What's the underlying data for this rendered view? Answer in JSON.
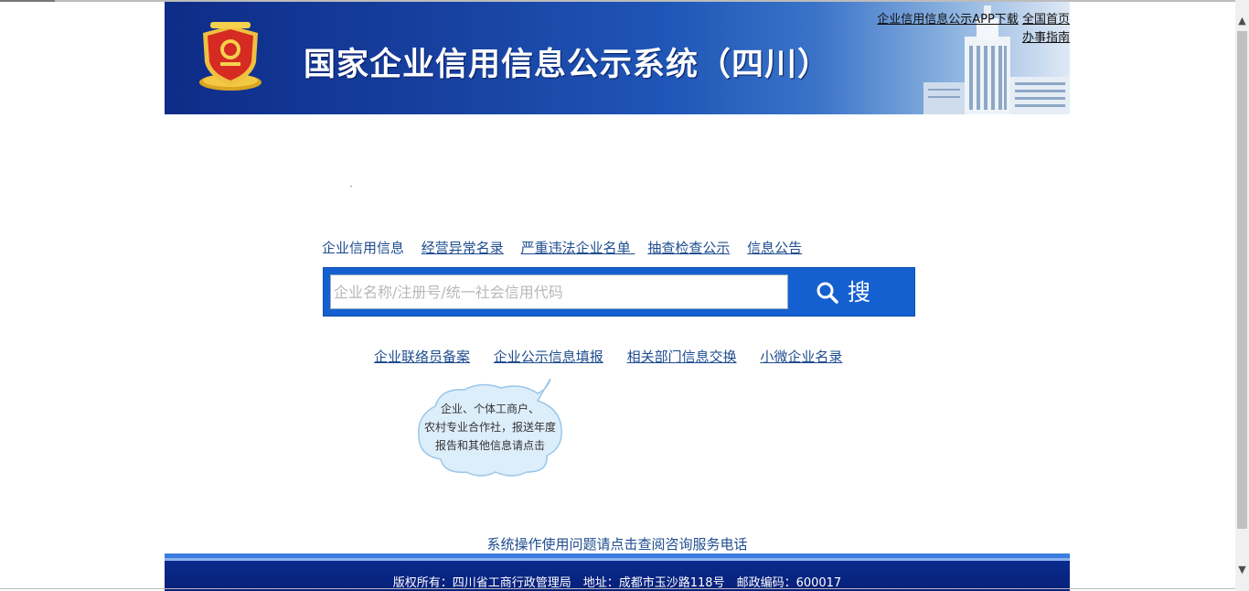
{
  "header": {
    "title": "国家企业信用信息公示系统（四川）",
    "links": [
      "企业信用信息公示APP下载",
      "全国首页",
      "办事指南"
    ]
  },
  "nav": {
    "tabs": [
      "企业信用信息",
      "经营异常名录",
      "严重违法企业名单 ",
      "抽查检查公示",
      "信息公告"
    ]
  },
  "search": {
    "placeholder": "企业名称/注册号/统一社会信用代码",
    "button_label": "搜 索"
  },
  "sub_links": [
    "企业联络员备案",
    "企业公示信息填报",
    "相关部门信息交换",
    "小微企业名录"
  ],
  "cloud": {
    "lines": [
      "企业、个体工商户、",
      "农村专业合作社，报送年度",
      "报告和其他信息请点击"
    ]
  },
  "footer": {
    "help_text": "系统操作使用问题请点击查阅咨询服务电话",
    "copyright": "版权所有：四川省工商行政管理局　地址：成都市玉沙路118号　邮政编码：600017"
  },
  "colors": {
    "header_blue": "#17409f",
    "search_blue": "#1460d0",
    "link_blue": "#1f4d8f",
    "footer_blue": "#0a2b8c"
  }
}
